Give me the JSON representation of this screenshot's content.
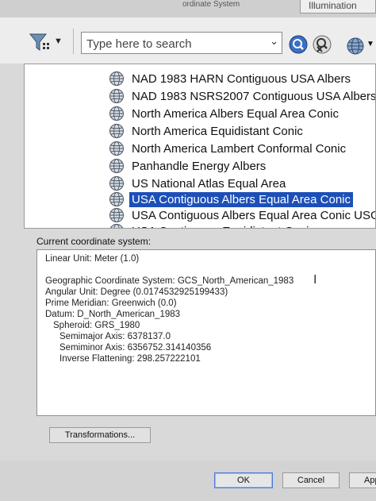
{
  "top": {
    "tab_label": "Illumination",
    "title_fragment": "ordinate System"
  },
  "toolbar": {
    "search_placeholder": "Type here to search",
    "icons": [
      "filter-icon",
      "search-icon",
      "clear-search-icon",
      "globe-icon"
    ]
  },
  "list": {
    "items": [
      {
        "label": "NAD 1983 HARN Contiguous USA Albers",
        "selected": false
      },
      {
        "label": "NAD 1983 NSRS2007 Contiguous USA Albers",
        "selected": false
      },
      {
        "label": "North America Albers Equal Area Conic",
        "selected": false
      },
      {
        "label": "North America Equidistant Conic",
        "selected": false
      },
      {
        "label": "North America Lambert Conformal Conic",
        "selected": false
      },
      {
        "label": "Panhandle Energy Albers",
        "selected": false
      },
      {
        "label": "US National Atlas Equal Area",
        "selected": false
      },
      {
        "label": "USA Contiguous Albers Equal Area Conic",
        "selected": true
      },
      {
        "label": "USA Contiguous Albers Equal Area Conic USGS",
        "selected": false
      },
      {
        "label": "USA Contiguous Equidistant Conic",
        "selected": false
      }
    ],
    "selected_color": "#1c4fb8"
  },
  "current": {
    "label": "Current coordinate system:",
    "lines": [
      "Linear Unit: Meter (1.0)",
      "Geographic Coordinate System: GCS_North_American_1983",
      "Angular Unit: Degree (0.0174532925199433)",
      "Prime Meridian: Greenwich (0.0)",
      "Datum: D_North_American_1983",
      "Spheroid: GRS_1980",
      "Semimajor Axis: 6378137.0",
      "Semiminor Axis: 6356752.314140356",
      "Inverse Flattening: 298.257222101"
    ]
  },
  "buttons": {
    "transformations": "Transformations...",
    "ok": "OK",
    "cancel": "Cancel",
    "apply": "Apply"
  }
}
